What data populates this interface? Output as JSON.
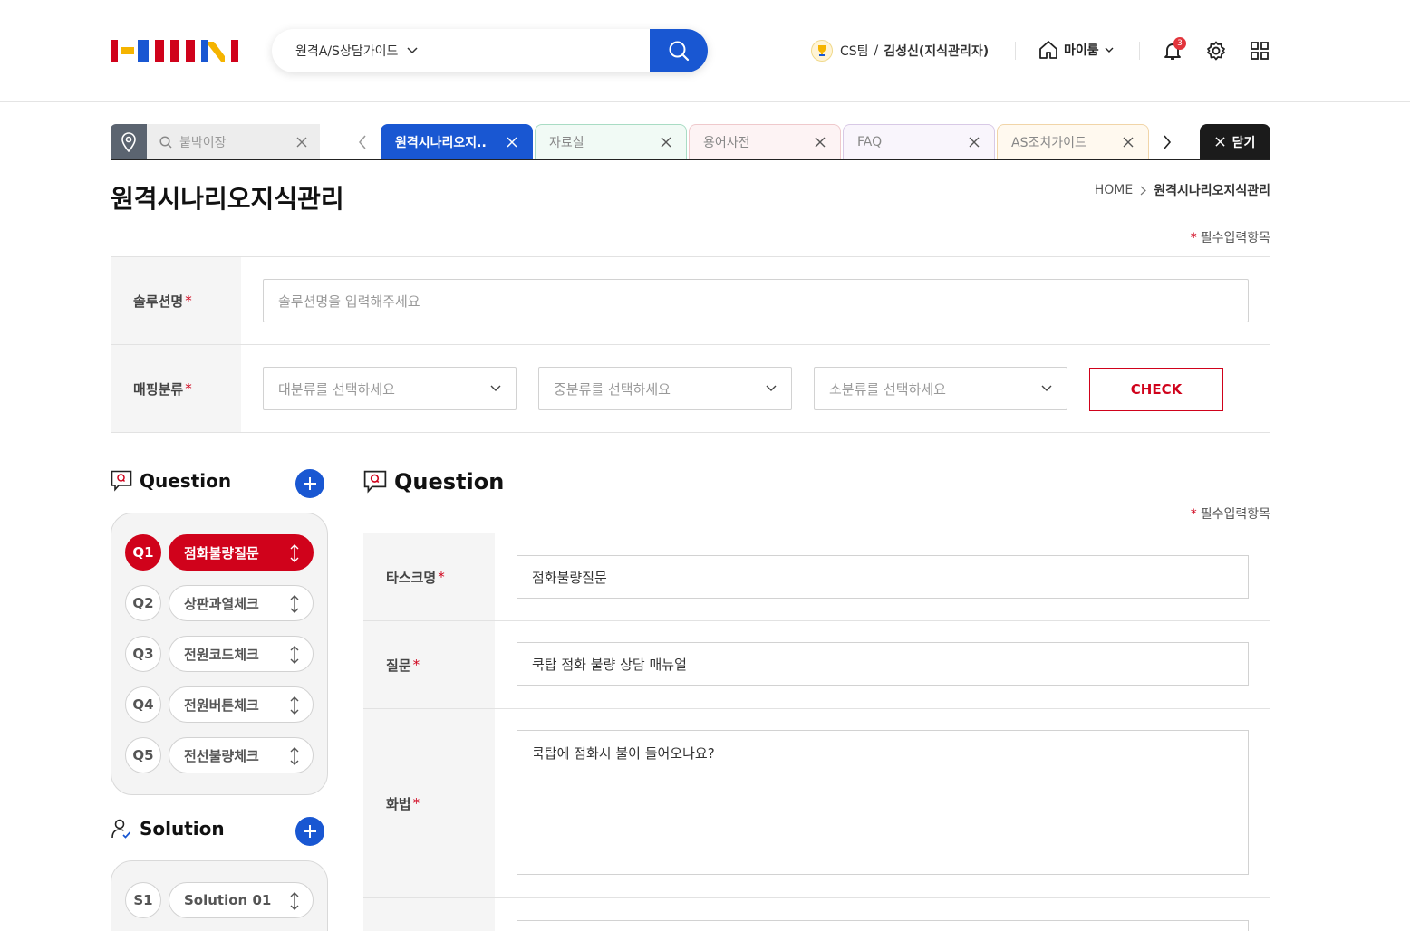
{
  "header": {
    "search_select": "원격A/S상담가이드",
    "user_team": "CS팀",
    "user_sep": "/",
    "user_name": "김성신(지식관리자)",
    "myroom_label": "마이룸",
    "notif_count": "3"
  },
  "tabbar": {
    "pin_placeholder": "붙박이장",
    "tabs": [
      {
        "label": "원격시나리오지..",
        "active": true
      },
      {
        "label": "자료실"
      },
      {
        "label": "용어사전"
      },
      {
        "label": "FAQ"
      },
      {
        "label": "AS조치가이드"
      }
    ],
    "close_all_label": "닫기"
  },
  "colors": {
    "primary_blue": "#1957d2",
    "accent_red": "#d0021b",
    "tab_borders": [
      "#1957d2",
      "#a9dcc4",
      "#efc9cc",
      "#d8c9e6",
      "#f1d5a8"
    ],
    "tab_backgrounds": [
      "#1957d2",
      "#f1faf5",
      "#fdf3f4",
      "#f9f5fc",
      "#fff9ef"
    ]
  },
  "page": {
    "title": "원격시나리오지식관리",
    "breadcrumb_home": "HOME",
    "breadcrumb_current": "원격시나리오지식관리",
    "required_note": "필수입력항목",
    "required_star": "*"
  },
  "form": {
    "solution_label": "솔루션명",
    "solution_placeholder": "솔루션명을 입력해주세요",
    "mapping_label": "매핑분류",
    "major_placeholder": "대분류를 선택하세요",
    "middle_placeholder": "중분류를 선택하세요",
    "minor_placeholder": "소분류를 선택하세요",
    "check_label": "CHECK"
  },
  "questions": {
    "title": "Question",
    "items": [
      {
        "num": "Q1",
        "label": "점화불량질문",
        "active": true
      },
      {
        "num": "Q2",
        "label": "상판과열체크"
      },
      {
        "num": "Q3",
        "label": "전원코드체크"
      },
      {
        "num": "Q4",
        "label": "전원버튼체크"
      },
      {
        "num": "Q5",
        "label": "전선불량체크"
      }
    ]
  },
  "solutions": {
    "title": "Solution",
    "items": [
      {
        "num": "S1",
        "label": "Solution 01"
      }
    ]
  },
  "question_detail": {
    "title": "Question",
    "required_note": "필수입력항목",
    "task_label": "타스크명",
    "task_value": "점화불량질문",
    "question_label": "질문",
    "question_value": "쿡탑 점화 불량 상담 매뉴얼",
    "script_label": "화법",
    "script_value": "쿡탑에 점화시 불이 들어오나요?"
  },
  "icons": [
    "search-icon",
    "chevron-down-icon",
    "home-icon",
    "bell-icon",
    "gear-icon",
    "grid-icon",
    "pin-icon",
    "close-icon",
    "chevron-left-icon",
    "chevron-right-icon",
    "plus-icon",
    "drag-icon",
    "question-icon",
    "user-check-icon"
  ]
}
